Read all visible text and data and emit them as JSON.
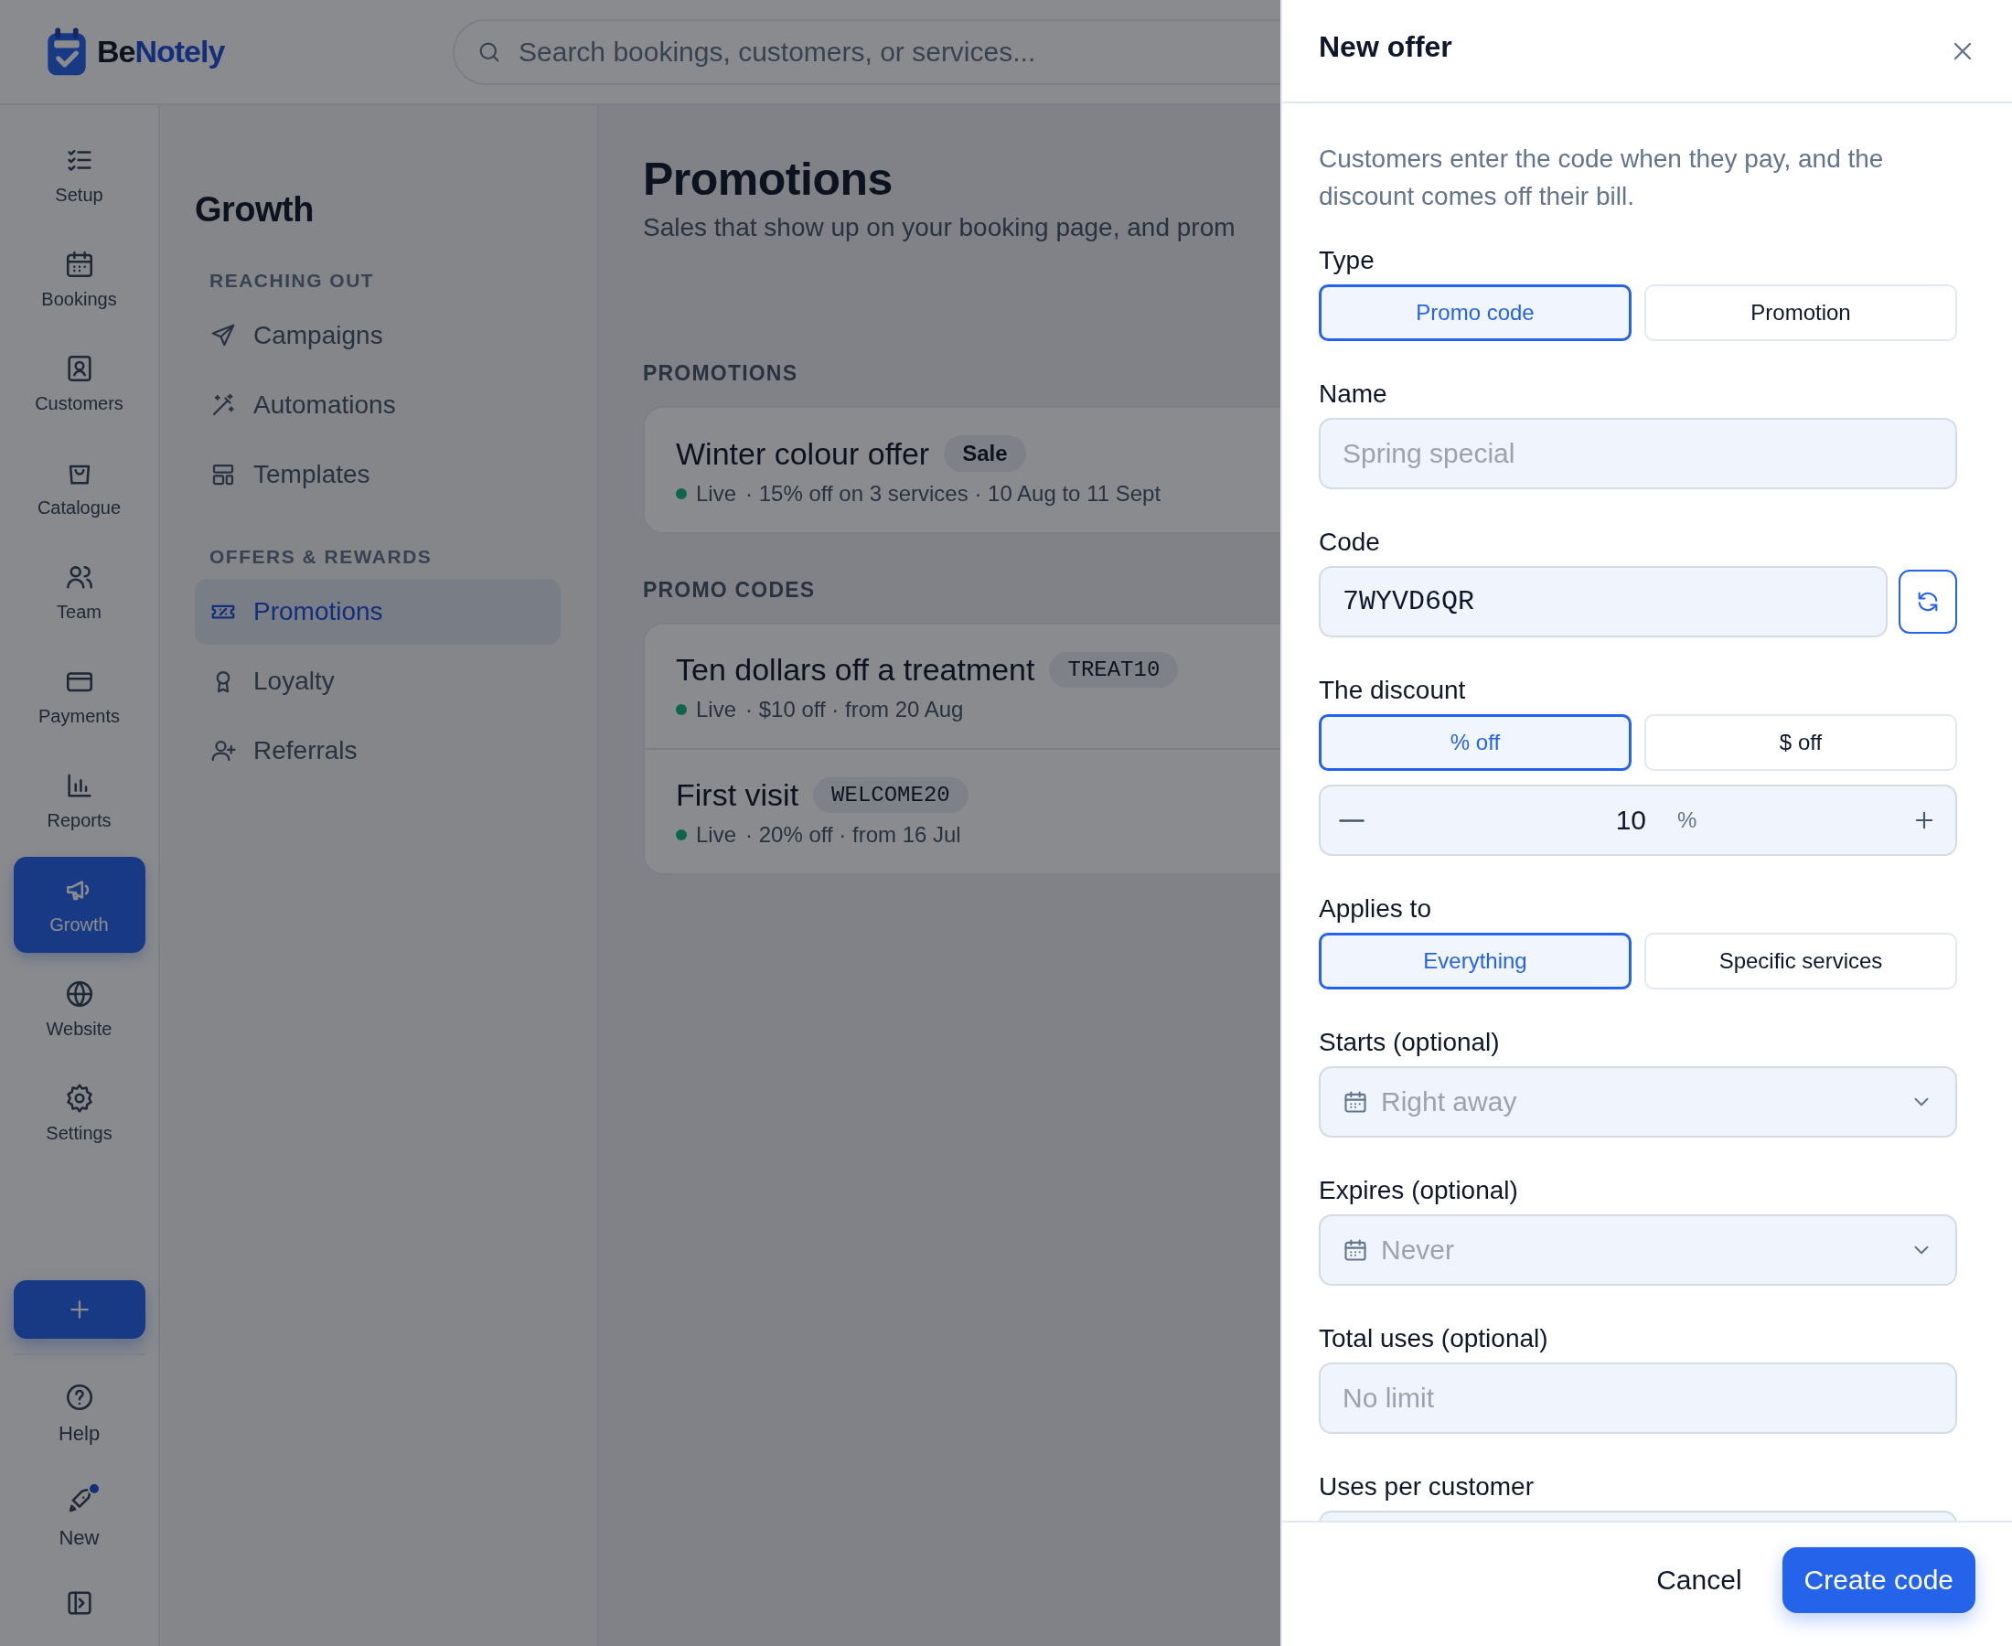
{
  "brand": {
    "name_start": "Be",
    "name_end": "Notely"
  },
  "search": {
    "placeholder": "Search bookings, customers, or services..."
  },
  "rail": {
    "items": [
      {
        "label": "Setup",
        "kind": "checklist",
        "selected": false
      },
      {
        "label": "Bookings",
        "kind": "calendar",
        "selected": false
      },
      {
        "label": "Customers",
        "kind": "contact",
        "selected": false
      },
      {
        "label": "Catalogue",
        "kind": "bag",
        "selected": false
      },
      {
        "label": "Team",
        "kind": "users",
        "selected": false
      },
      {
        "label": "Payments",
        "kind": "card",
        "selected": false
      },
      {
        "label": "Reports",
        "kind": "chart",
        "selected": false
      },
      {
        "label": "Growth",
        "kind": "megaphone",
        "selected": true
      },
      {
        "label": "Website",
        "kind": "globe",
        "selected": false
      },
      {
        "label": "Settings",
        "kind": "gear",
        "selected": false
      }
    ],
    "bottom_items": [
      {
        "label": "Help",
        "kind": "help",
        "badge": false
      },
      {
        "label": "New",
        "kind": "rocket",
        "badge": true
      }
    ]
  },
  "nav": {
    "title": "Growth",
    "sections": [
      {
        "heading": "REACHING OUT",
        "items": [
          {
            "label": "Campaigns",
            "kind": "send",
            "selected": false
          },
          {
            "label": "Automations",
            "kind": "wand",
            "selected": false
          },
          {
            "label": "Templates",
            "kind": "layout",
            "selected": false
          }
        ]
      },
      {
        "heading": "OFFERS & REWARDS",
        "items": [
          {
            "label": "Promotions",
            "kind": "ticket",
            "selected": true
          },
          {
            "label": "Loyalty",
            "kind": "award",
            "selected": false
          },
          {
            "label": "Referrals",
            "kind": "userplus",
            "selected": false
          }
        ]
      }
    ]
  },
  "main": {
    "title": "Promotions",
    "subtitle": "Sales that show up on your booking page, and prom",
    "sections": [
      {
        "heading": "PROMOTIONS",
        "rows": [
          {
            "name": "Winter colour offer",
            "tag": "Sale",
            "kind": "label",
            "status": "Live",
            "details": "· 15% off on 3 services · 10 Aug to 11 Sept"
          }
        ]
      },
      {
        "heading": "PROMO CODES",
        "rows": [
          {
            "name": "Ten dollars off a treatment",
            "tag": "TREAT10",
            "kind": "code",
            "status": "Live",
            "details": "· $10 off · from 20 Aug"
          },
          {
            "name": "First visit",
            "tag": "WELCOME20",
            "kind": "code",
            "status": "Live",
            "details": "· 20% off · from 16 Jul"
          }
        ]
      }
    ]
  },
  "drawer": {
    "title": "New offer",
    "description": "Customers enter the code when they pay, and the discount comes off their bill.",
    "fields": [
      {
        "kind": "segmented",
        "label": "Type",
        "options": [
          {
            "label": "Promo code",
            "selected": true
          },
          {
            "label": "Promotion",
            "selected": false
          }
        ]
      },
      {
        "kind": "text",
        "label": "Name",
        "placeholder": "Spring special"
      },
      {
        "kind": "code",
        "label": "Code",
        "value": "7WYVD6QR"
      },
      {
        "kind": "segmented",
        "label": "The discount",
        "options": [
          {
            "label": "% off",
            "selected": true
          },
          {
            "label": "$ off",
            "selected": false
          }
        ]
      },
      {
        "kind": "stepper",
        "value": "10",
        "unit": "%"
      },
      {
        "kind": "segmented",
        "label": "Applies to",
        "options": [
          {
            "label": "Everything",
            "selected": true
          },
          {
            "label": "Specific services",
            "selected": false
          }
        ]
      },
      {
        "kind": "date",
        "label": "Starts (optional)",
        "placeholder": "Right away"
      },
      {
        "kind": "date",
        "label": "Expires (optional)",
        "placeholder": "Never"
      },
      {
        "kind": "text",
        "label": "Total uses (optional)",
        "placeholder": "No limit"
      },
      {
        "kind": "text",
        "label": "Uses per customer"
      }
    ],
    "cancel": "Cancel",
    "submit": "Create code"
  }
}
